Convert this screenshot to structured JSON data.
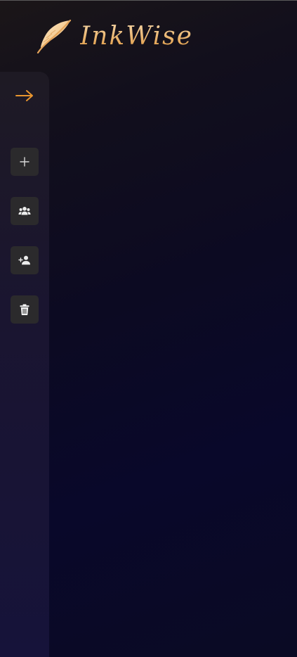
{
  "brand": {
    "name": "InkWise",
    "logo_icon": "feather-icon"
  },
  "sidebar": {
    "expand_icon": "arrow-right-icon",
    "actions": [
      {
        "icon": "plus-icon",
        "name": "new-button"
      },
      {
        "icon": "group-icon",
        "name": "groups-button"
      },
      {
        "icon": "add-user-icon",
        "name": "add-user-button"
      },
      {
        "icon": "trash-icon",
        "name": "delete-button"
      }
    ]
  },
  "colors": {
    "accent": "#e8952f",
    "brand_text": "#f1c58a",
    "button_bg": "#2b2a2c",
    "icon": "#e6e6e6"
  }
}
